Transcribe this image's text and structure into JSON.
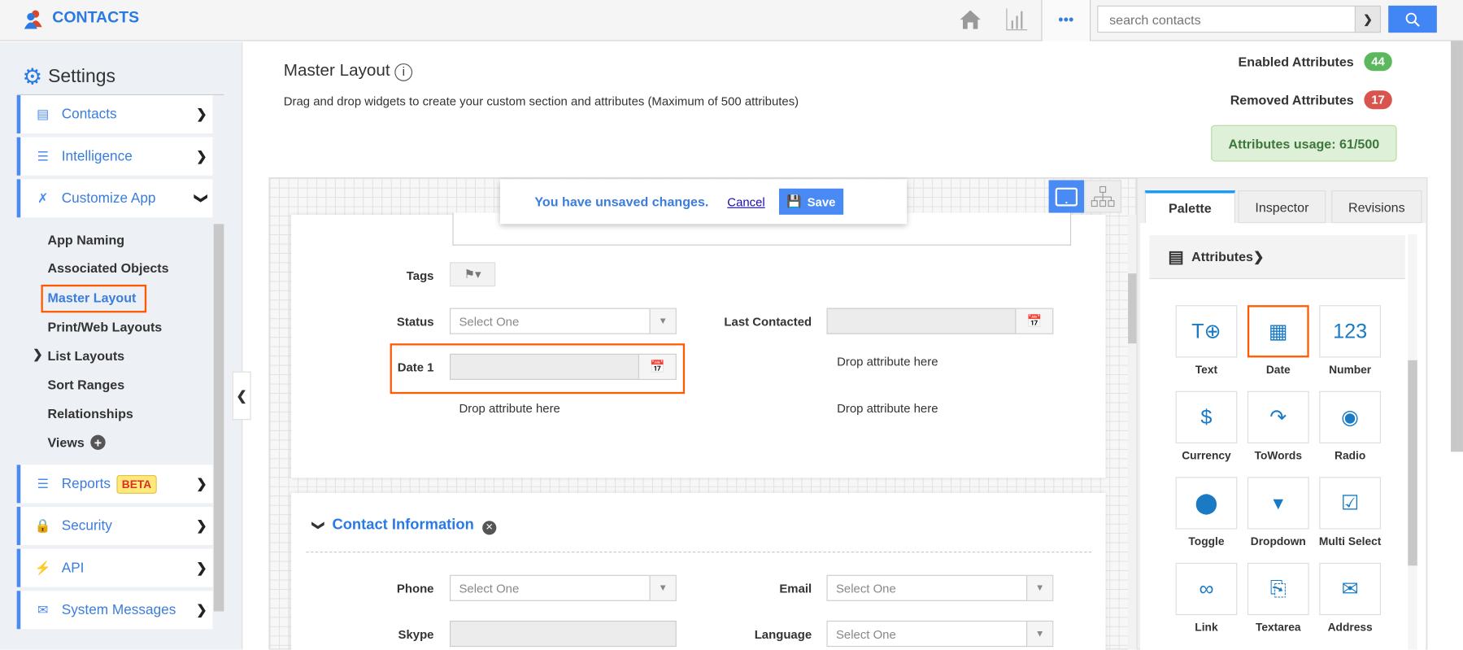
{
  "header": {
    "app_title": "CONTACTS",
    "search_placeholder": "search contacts",
    "more_label": "•••"
  },
  "sidebar": {
    "title": "Settings",
    "menu": [
      {
        "label": "Contacts",
        "icon": "contacts-card-icon"
      },
      {
        "label": "Intelligence",
        "icon": "intelligence-list-icon"
      },
      {
        "label": "Customize App",
        "icon": "tools-icon"
      }
    ],
    "subitems": [
      "App Naming",
      "Associated Objects",
      "Master Layout",
      "Print/Web Layouts",
      "List Layouts",
      "Sort Ranges",
      "Relationships",
      "Views"
    ],
    "menu2": [
      {
        "label": "Reports",
        "icon": "reports-icon",
        "badge": "BETA"
      },
      {
        "label": "Security",
        "icon": "lock-icon"
      },
      {
        "label": "API",
        "icon": "plug-icon"
      },
      {
        "label": "System Messages",
        "icon": "message-icon"
      }
    ]
  },
  "main": {
    "title": "Master Layout",
    "subtitle": "Drag and drop widgets to create your custom section and attributes (Maximum of 500 attributes)",
    "enabled_label": "Enabled Attributes",
    "enabled_count": "44",
    "removed_label": "Removed Attributes",
    "removed_count": "17",
    "usage": "Attributes usage: 61/500",
    "colors": {
      "accent": "#4a8af4",
      "enabled": "#5cb85c",
      "removed": "#d9534f",
      "highlight": "#ff5a00"
    }
  },
  "unsaved": {
    "message": "You have unsaved changes.",
    "cancel": "Cancel",
    "save": "Save"
  },
  "form": {
    "tags_label": "Tags",
    "status_label": "Status",
    "status_value": "Select One",
    "last_contacted_label": "Last Contacted",
    "date1_label": "Date 1",
    "drop_text": "Drop attribute here",
    "section_title": "Contact Information",
    "phone_label": "Phone",
    "phone_value": "Select One",
    "email_label": "Email",
    "email_value": "Select One",
    "skype_label": "Skype",
    "language_label": "Language",
    "language_value": "Select One"
  },
  "panel": {
    "tabs": [
      "Palette",
      "Inspector",
      "Revisions"
    ],
    "active_tab": "Palette",
    "section": "Attributes",
    "widgets": [
      "Text",
      "Date",
      "Number",
      "Currency",
      "ToWords",
      "Radio",
      "Toggle",
      "Dropdown",
      "Multi Select",
      "Link",
      "Textarea",
      "Address"
    ],
    "selected_widget": "Date"
  }
}
